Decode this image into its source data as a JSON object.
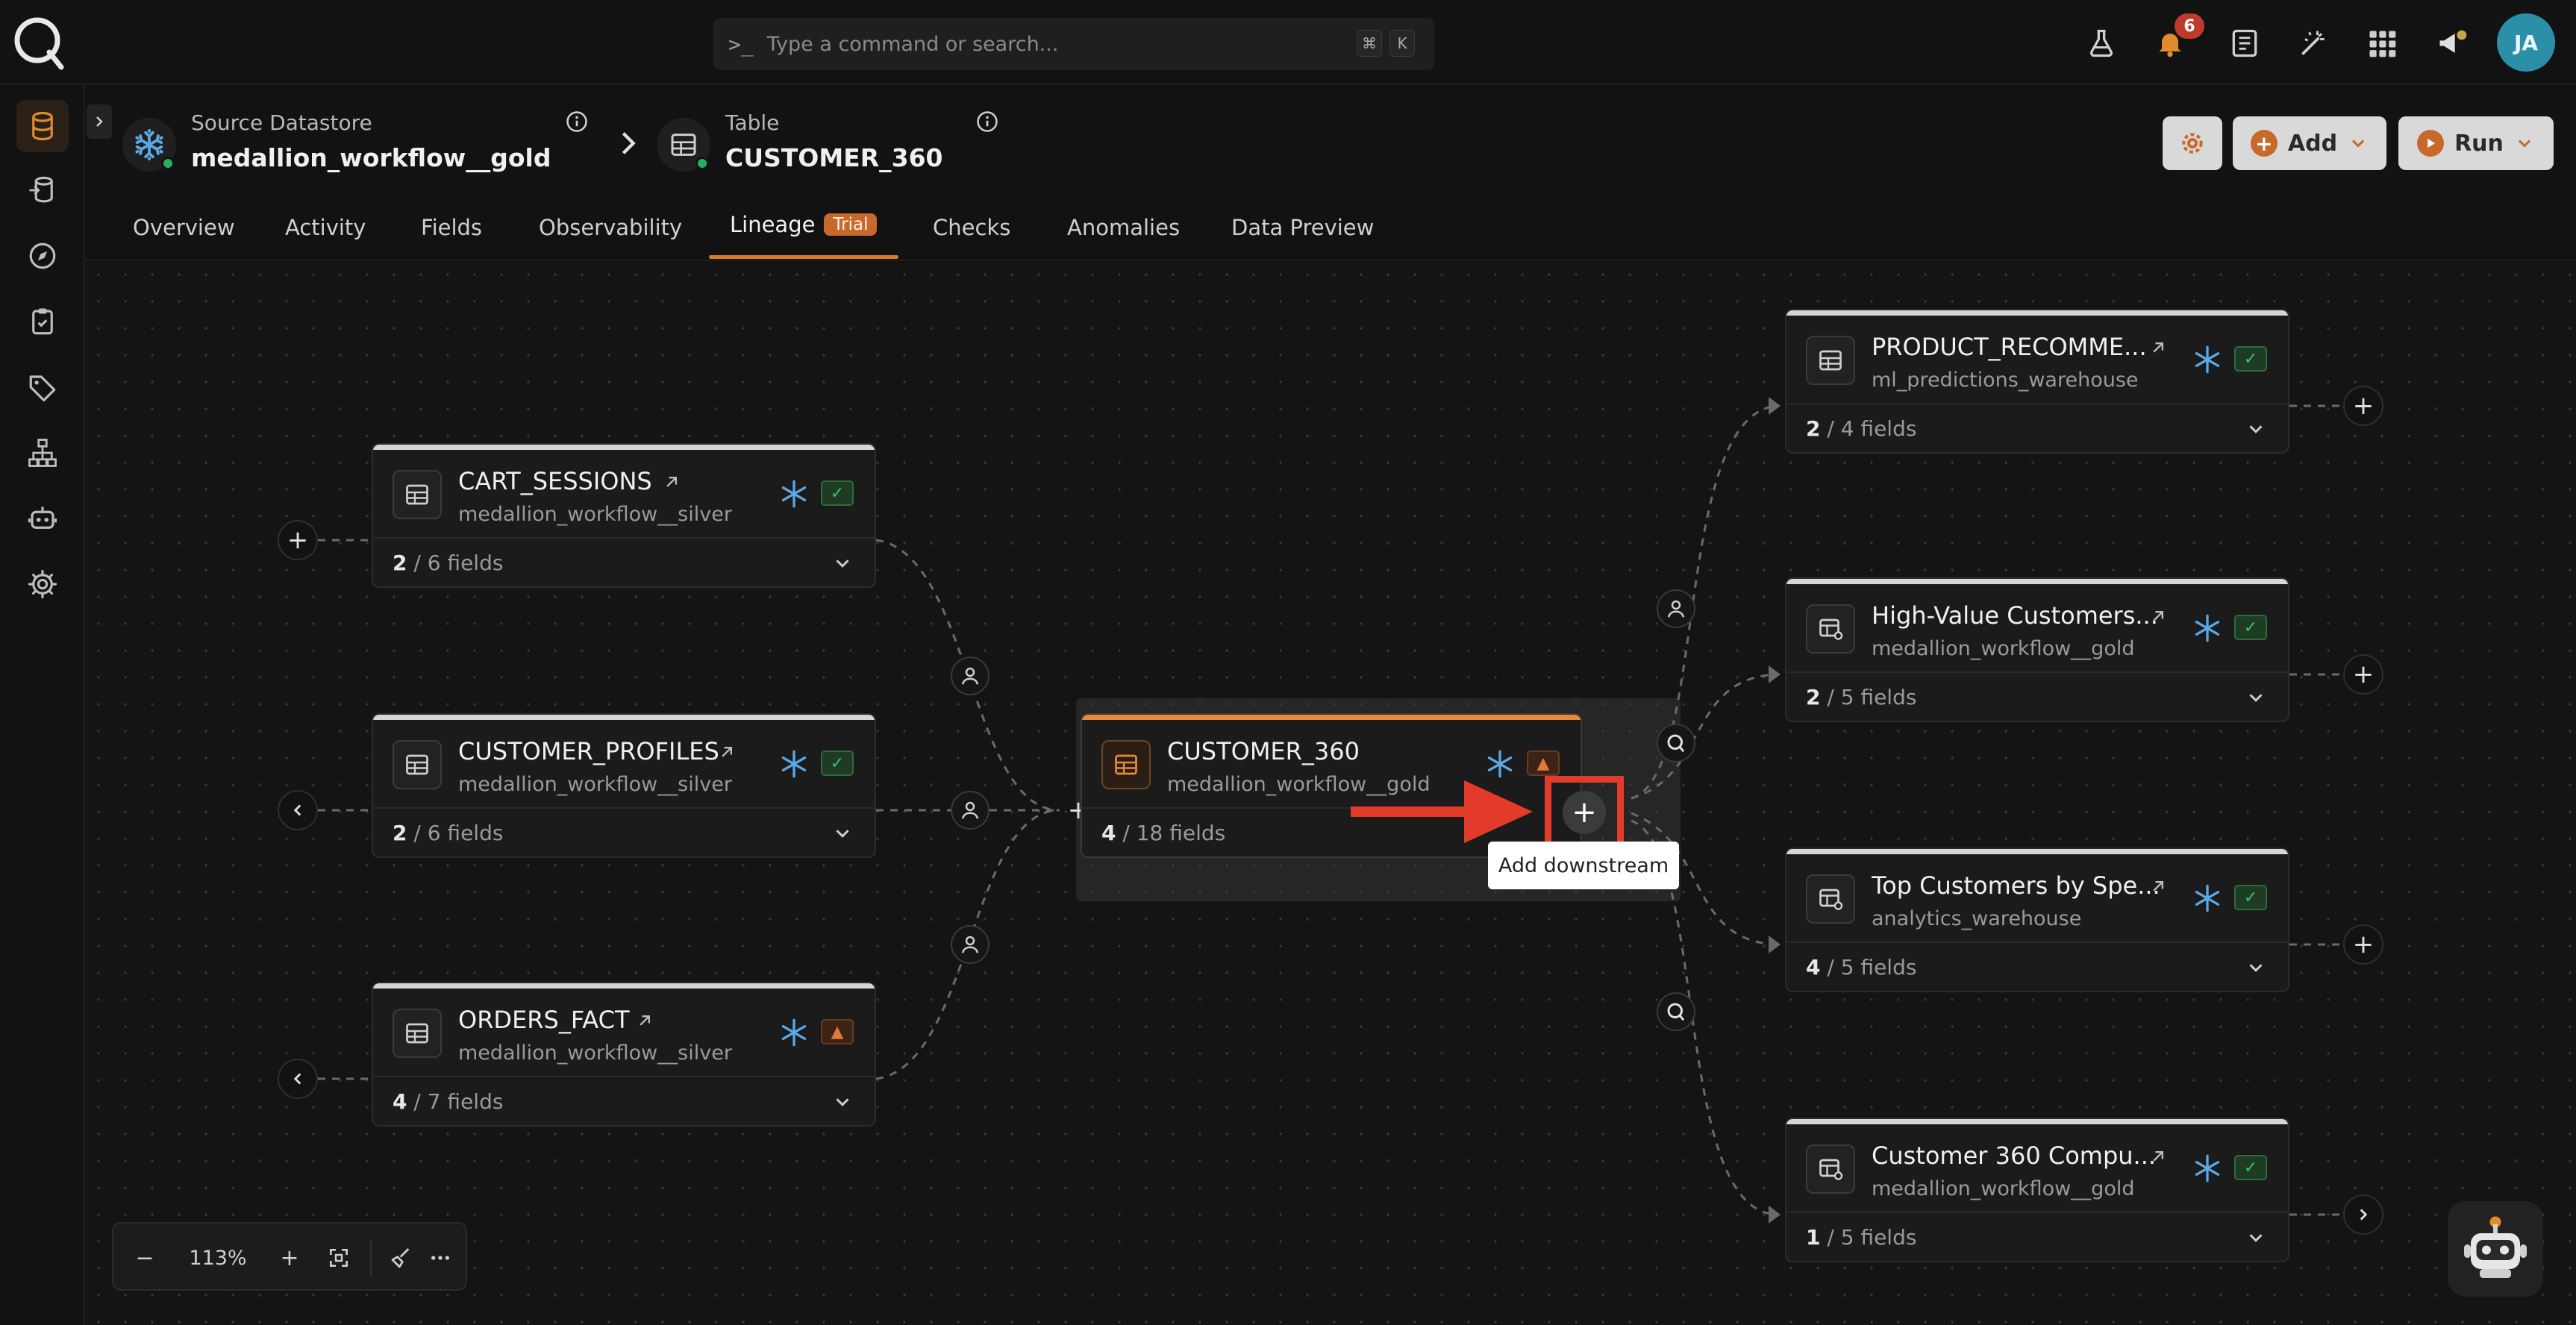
{
  "command_bar": {
    "placeholder": "Type a command or search...",
    "shortcut_mod": "⌘",
    "shortcut_key": "K"
  },
  "notifications": {
    "count": "6"
  },
  "user": {
    "initials": "JA"
  },
  "breadcrumb": {
    "source_label": "Source Datastore",
    "source_value": "medallion_workflow__gold",
    "table_label": "Table",
    "table_value": "CUSTOMER_360"
  },
  "actions": {
    "add_label": "Add",
    "run_label": "Run"
  },
  "tabs": [
    {
      "label": "Overview"
    },
    {
      "label": "Activity"
    },
    {
      "label": "Fields"
    },
    {
      "label": "Observability"
    },
    {
      "label": "Lineage",
      "badge": "Trial"
    },
    {
      "label": "Checks"
    },
    {
      "label": "Anomalies"
    },
    {
      "label": "Data Preview"
    }
  ],
  "nodes": {
    "cart_sessions": {
      "title": "CART_SESSIONS",
      "subtitle": "medallion_workflow__silver",
      "fields_shown": "2",
      "fields_total": " / 6 fields"
    },
    "customer_profiles": {
      "title": "CUSTOMER_PROFILES",
      "subtitle": "medallion_workflow__silver",
      "fields_shown": "2",
      "fields_total": " / 6 fields"
    },
    "orders_fact": {
      "title": "ORDERS_FACT",
      "subtitle": "medallion_workflow__silver",
      "fields_shown": "4",
      "fields_total": " / 7 fields"
    },
    "customer_360": {
      "title": "CUSTOMER_360",
      "subtitle": "medallion_workflow__gold",
      "fields_shown": "4",
      "fields_total": " / 18 fields"
    },
    "product_recomme": {
      "title": "PRODUCT_RECOMME...",
      "subtitle": "ml_predictions_warehouse",
      "fields_shown": "2",
      "fields_total": " / 4 fields"
    },
    "high_value": {
      "title": "High-Value Customers...",
      "subtitle": "medallion_workflow__gold",
      "fields_shown": "2",
      "fields_total": " / 5 fields"
    },
    "top_customers": {
      "title": "Top Customers by Spe...",
      "subtitle": "analytics_warehouse",
      "fields_shown": "4",
      "fields_total": " / 5 fields"
    },
    "customer_360_compu": {
      "title": "Customer 360 Compu...",
      "subtitle": "medallion_workflow__gold",
      "fields_shown": "1",
      "fields_total": " / 5 fields"
    }
  },
  "tooltip": {
    "text": "Add downstream"
  },
  "zoom": {
    "level": "113%"
  },
  "colors": {
    "accent": "#d57b2f",
    "ok": "#3ec266",
    "warn": "#e0793a",
    "callout": "#e23b2a",
    "snowflake": "#5aa9e6"
  }
}
